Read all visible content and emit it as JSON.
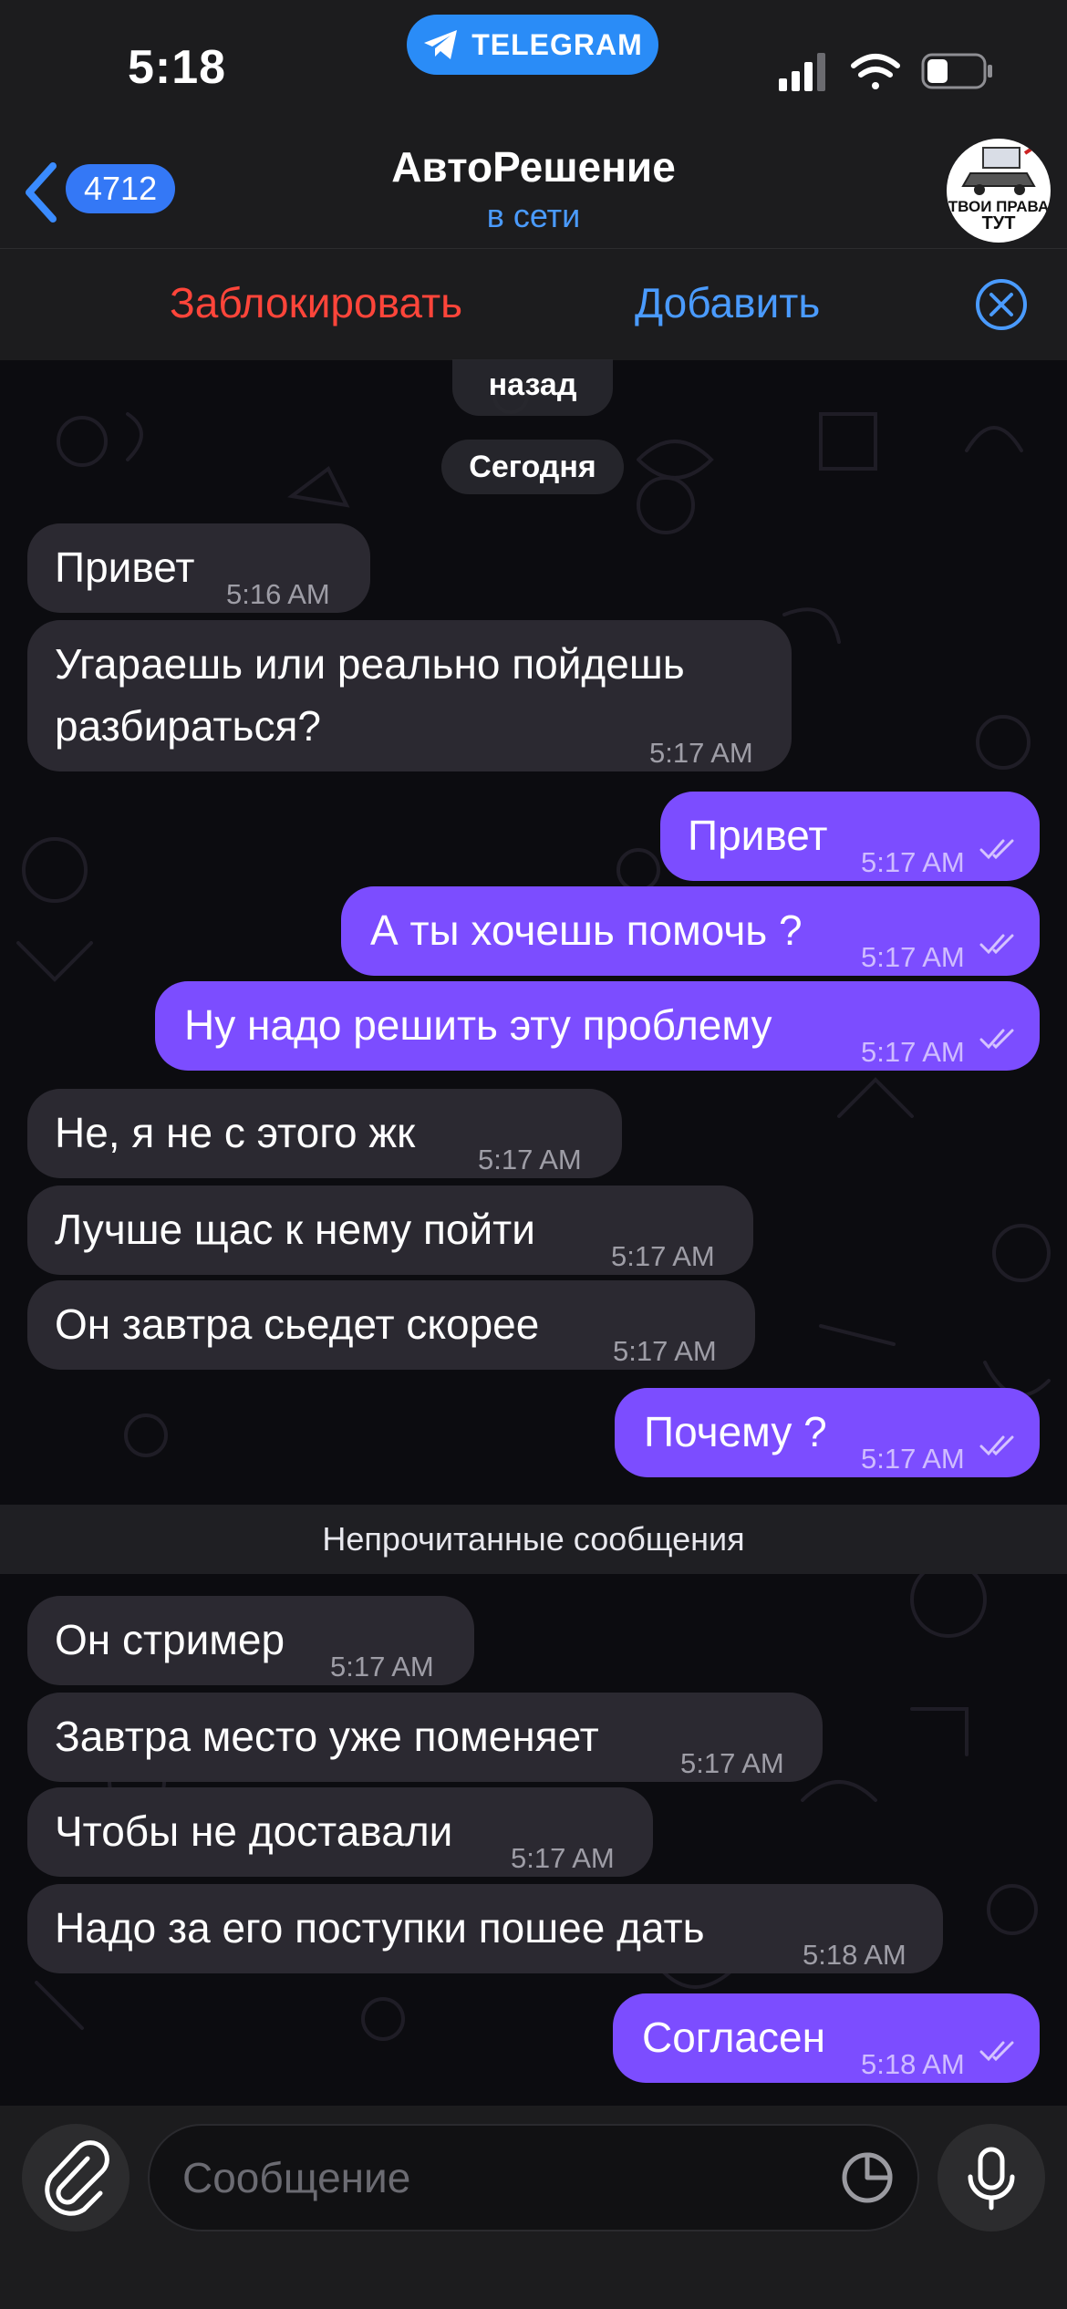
{
  "status_bar": {
    "time": "5:18",
    "app_pill": "TELEGRAM"
  },
  "header": {
    "back_count": "4712",
    "title": "АвтоРешение",
    "subtitle": "в сети",
    "avatar_text_line1": "ТВОИ ПРАВА",
    "avatar_text_line2": "ТУТ"
  },
  "action_bar": {
    "block_label": "Заблокировать",
    "add_label": "Добавить"
  },
  "date_pills": {
    "prev": "назад",
    "today": "Сегодня"
  },
  "messages": [
    {
      "dir": "in",
      "text": "Привет",
      "time": "5:16 AM"
    },
    {
      "dir": "in",
      "text_line1": "Угараешь или реально пойдешь",
      "text_line2": "разбираться?",
      "time": "5:17 AM"
    },
    {
      "dir": "out",
      "text": "Привет",
      "time": "5:17 AM"
    },
    {
      "dir": "out",
      "text": "А ты хочешь помочь ?",
      "time": "5:17 AM"
    },
    {
      "dir": "out",
      "text": "Ну надо решить эту проблему",
      "time": "5:17 AM"
    },
    {
      "dir": "in",
      "text": "Не, я не с этого жк",
      "time": "5:17 AM"
    },
    {
      "dir": "in",
      "text": "Лучше щас к нему пойти",
      "time": "5:17 AM"
    },
    {
      "dir": "in",
      "text": "Он завтра сьедет скорее",
      "time": "5:17 AM"
    },
    {
      "dir": "out",
      "text": "Почему ?",
      "time": "5:17 AM"
    },
    {
      "dir": "in",
      "text": "Он стример",
      "time": "5:17 AM"
    },
    {
      "dir": "in",
      "text": "Завтра место уже поменяет",
      "time": "5:17 AM"
    },
    {
      "dir": "in",
      "text": "Чтобы не доставали",
      "time": "5:17 AM"
    },
    {
      "dir": "in",
      "text": "Надо за его поступки пошее дать",
      "time": "5:18 AM"
    },
    {
      "dir": "out",
      "text": "Согласен",
      "time": "5:18 AM"
    }
  ],
  "unread_divider": "Непрочитанные сообщения",
  "input": {
    "placeholder": "Сообщение"
  },
  "colors": {
    "outgoing_bubble": "#7c4dff",
    "incoming_bubble": "#2b2931",
    "accent_blue": "#3478f6",
    "block_red": "#ff453a"
  },
  "icons": [
    "telegram-plane-icon",
    "signal-icon",
    "wifi-icon",
    "battery-icon",
    "back-chevron-icon",
    "close-circle-icon",
    "double-check-icon",
    "paperclip-icon",
    "sticker-icon",
    "microphone-icon"
  ]
}
